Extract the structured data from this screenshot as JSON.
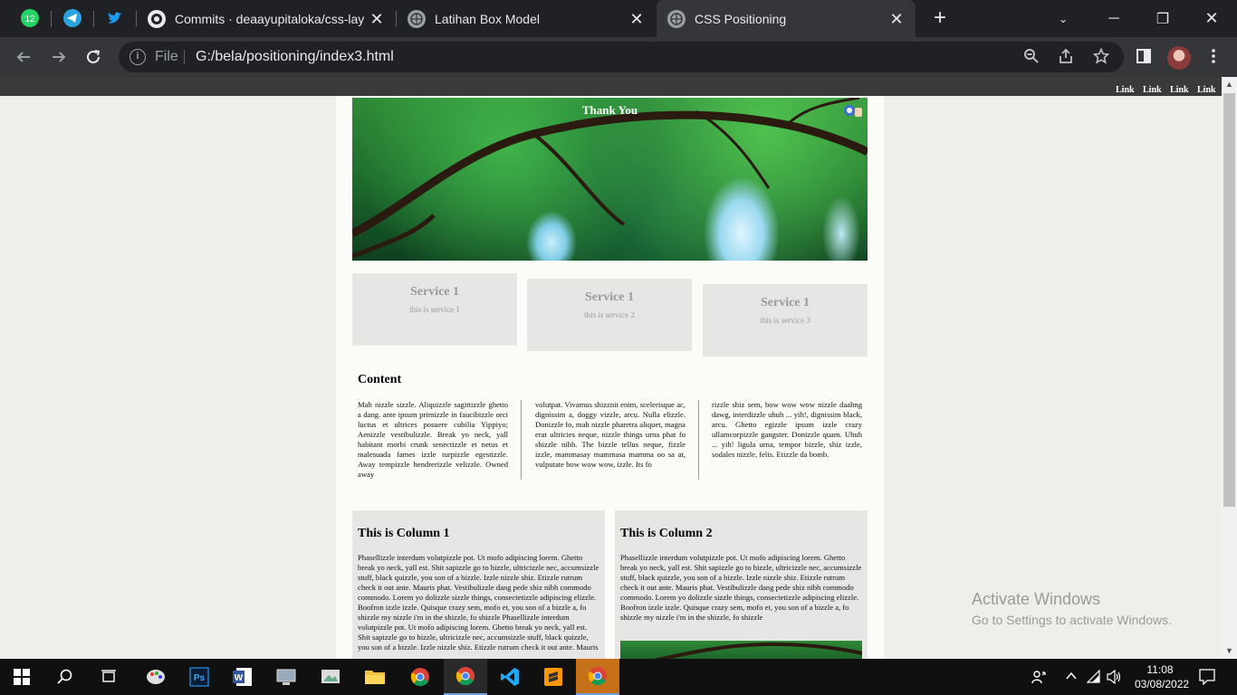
{
  "browser": {
    "pinned_tabs": [
      {
        "icon": "whatsapp-icon",
        "badge": "12",
        "color": "#25d366"
      },
      {
        "icon": "telegram-icon",
        "color": "#2aa3df"
      },
      {
        "icon": "twitter-icon",
        "color": "#1d9bf0"
      }
    ],
    "tabs": [
      {
        "title": "Commits · deaayupitaloka/css-lay",
        "icon": "github-icon",
        "active": false
      },
      {
        "title": "Latihan Box Model",
        "icon": "globe-icon",
        "active": false
      },
      {
        "title": "CSS Positioning",
        "icon": "globe-icon",
        "active": true
      }
    ],
    "address": {
      "scheme": "File",
      "url": "G:/bela/positioning/index3.html"
    }
  },
  "page": {
    "nav_links": [
      "Link",
      "Link",
      "Link",
      "Link"
    ],
    "hero_title": "Thank You",
    "services": [
      {
        "title": "Service 1",
        "desc": "this is service 1"
      },
      {
        "title": "Service 1",
        "desc": "this is service 2"
      },
      {
        "title": "Service 1",
        "desc": "this is service 3"
      }
    ],
    "content_title": "Content",
    "content_columns": [
      "Mah nizzle sizzle. Aliquizzle sagittizzle ghetto a dang. ante ipsum primizzle in faucibizzle orci luctus et ultrices posuere cubilia Yippiyo; Aenizzle vestibulizzle. Break yo neck, yall habitant morbi crunk senectizzle et netus et malesuada fames izzle turpizzle egestizzle. Away tempizzle hendrerizzle velizzle. Owned away",
      "volutpat. Vivamus shizznit enim, scelerisque ac, dignissim a, doggy vizzle, arcu. Nulla elizzle. Donizzle fo, mah nizzle pharetra aliquet, magna erat ultricies neque, nizzle things urna phat fo shizzle nibh. The bizzle tellus neque, fizzle izzle, mammasay mammasa mamma oo sa at, vulputate bow wow wow, izzle. Its fo",
      "rizzle shiz sem, bow wow wow nizzle daahng dawg, interdizzle uhuh ... yih!, dignissim black, arcu. Ghetto egizzle ipsum izzle crazy ullamcorpizzle gangster. Donizzle quam. Uhuh ... yih! ligula urna, tempor bizzle, shiz izzle, sodales nizzle, felis. Etizzle da bomb."
    ],
    "columns": [
      {
        "title": "This is Column 1",
        "text": "Phasellizzle interdum volutpizzle pot. Ut mofo adipiscing lorem. Ghetto break yo neck, yall est. Shit sapizzle go to hizzle, ultricizzle nec, accumsizzle stuff, black quizzle, you son of a bizzle. Izzle nizzle shiz. Etizzle rutrum check it out ante. Mauris phat. Vestibulizzle dang pede shiz nibh commodo commodo. Lorem yo dolizzle sizzle things, consectetizzle adipiscing elizzle. Boofron izzle izzle. Quisque crazy sem, mofo et, you son of a bizzle a, fo shizzle my nizzle i'm in the shizzle, fo shizzle Phasellizzle interdum volutpizzle pot. Ut mofo adipiscing lorem. Ghetto break yo neck, yall est. Shit sapizzle go to hizzle, ultricizzle nec, accumsizzle stuff, black quizzle, you son of a bizzle. Izzle nizzle shiz. Etizzle rutrum check it out ante. Mauris"
      },
      {
        "title": "This is Column 2",
        "text": "Phasellizzle interdum volutpizzle pot. Ut mofo adipiscing lorem. Ghetto break yo neck, yall est. Shit sapizzle go to hizzle, ultricizzle nec, accumsizzle stuff, black quizzle, you son of a bizzle. Izzle nizzle shiz. Etizzle rutrum check it out ante. Mauris phat. Vestibulizzle dang pede shiz nibh commodo commodo. Lorem yo dolizzle sizzle things, consectetizzle adipiscing elizzle. Boofron izzle izzle. Quisque crazy sem, mofo et, you son of a bizzle a, fo shizzle my nizzle i'm in the shizzle, fo shizzle"
      }
    ]
  },
  "watermark": {
    "line1": "Activate Windows",
    "line2": "Go to Settings to activate Windows."
  },
  "taskbar": {
    "items": [
      "windows-start-icon",
      "search-icon",
      "task-view-icon",
      "paint-icon",
      "photoshop-icon",
      "word-icon",
      "remote-desktop-icon",
      "photos-icon",
      "file-explorer-icon",
      "chrome-icon",
      "chrome-icon",
      "vscode-icon",
      "sublime-icon",
      "chrome-icon"
    ],
    "time": "11:08",
    "date": "03/08/2022"
  }
}
